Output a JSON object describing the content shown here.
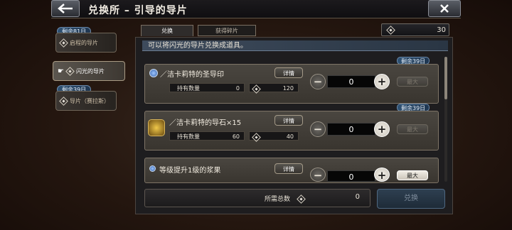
{
  "header": {
    "title": "兑换所 – 引导的导片"
  },
  "sidebar": {
    "items": [
      {
        "tag": "剩余81日",
        "label": "启程的导片"
      },
      {
        "label": "闪光的导片"
      },
      {
        "tag": "剩余39日",
        "label": "导片（赛拉斯）"
      }
    ]
  },
  "tabs": [
    "兑换",
    "获得碎片"
  ],
  "currency": {
    "value": "30"
  },
  "banner": "可以将闪光的导片兑换成道具。",
  "items": [
    {
      "remain": "剩余39日",
      "name": "／洁卡莉特的圣导印",
      "detail": "详情",
      "hold_label": "持有数量",
      "hold": "0",
      "cost": "120",
      "qty": "0",
      "max": "最大"
    },
    {
      "remain": "剩余39日",
      "name": "／洁卡莉特的导石×15",
      "detail": "详情",
      "hold_label": "持有数量",
      "hold": "60",
      "cost": "40",
      "qty": "0",
      "max": "最大"
    },
    {
      "name": "等级提升1级的浆果",
      "detail": "详情",
      "qty": "0",
      "max": "最大"
    }
  ],
  "footer": {
    "label": "所需总数",
    "value": "0"
  },
  "exchange_button": "兑换"
}
